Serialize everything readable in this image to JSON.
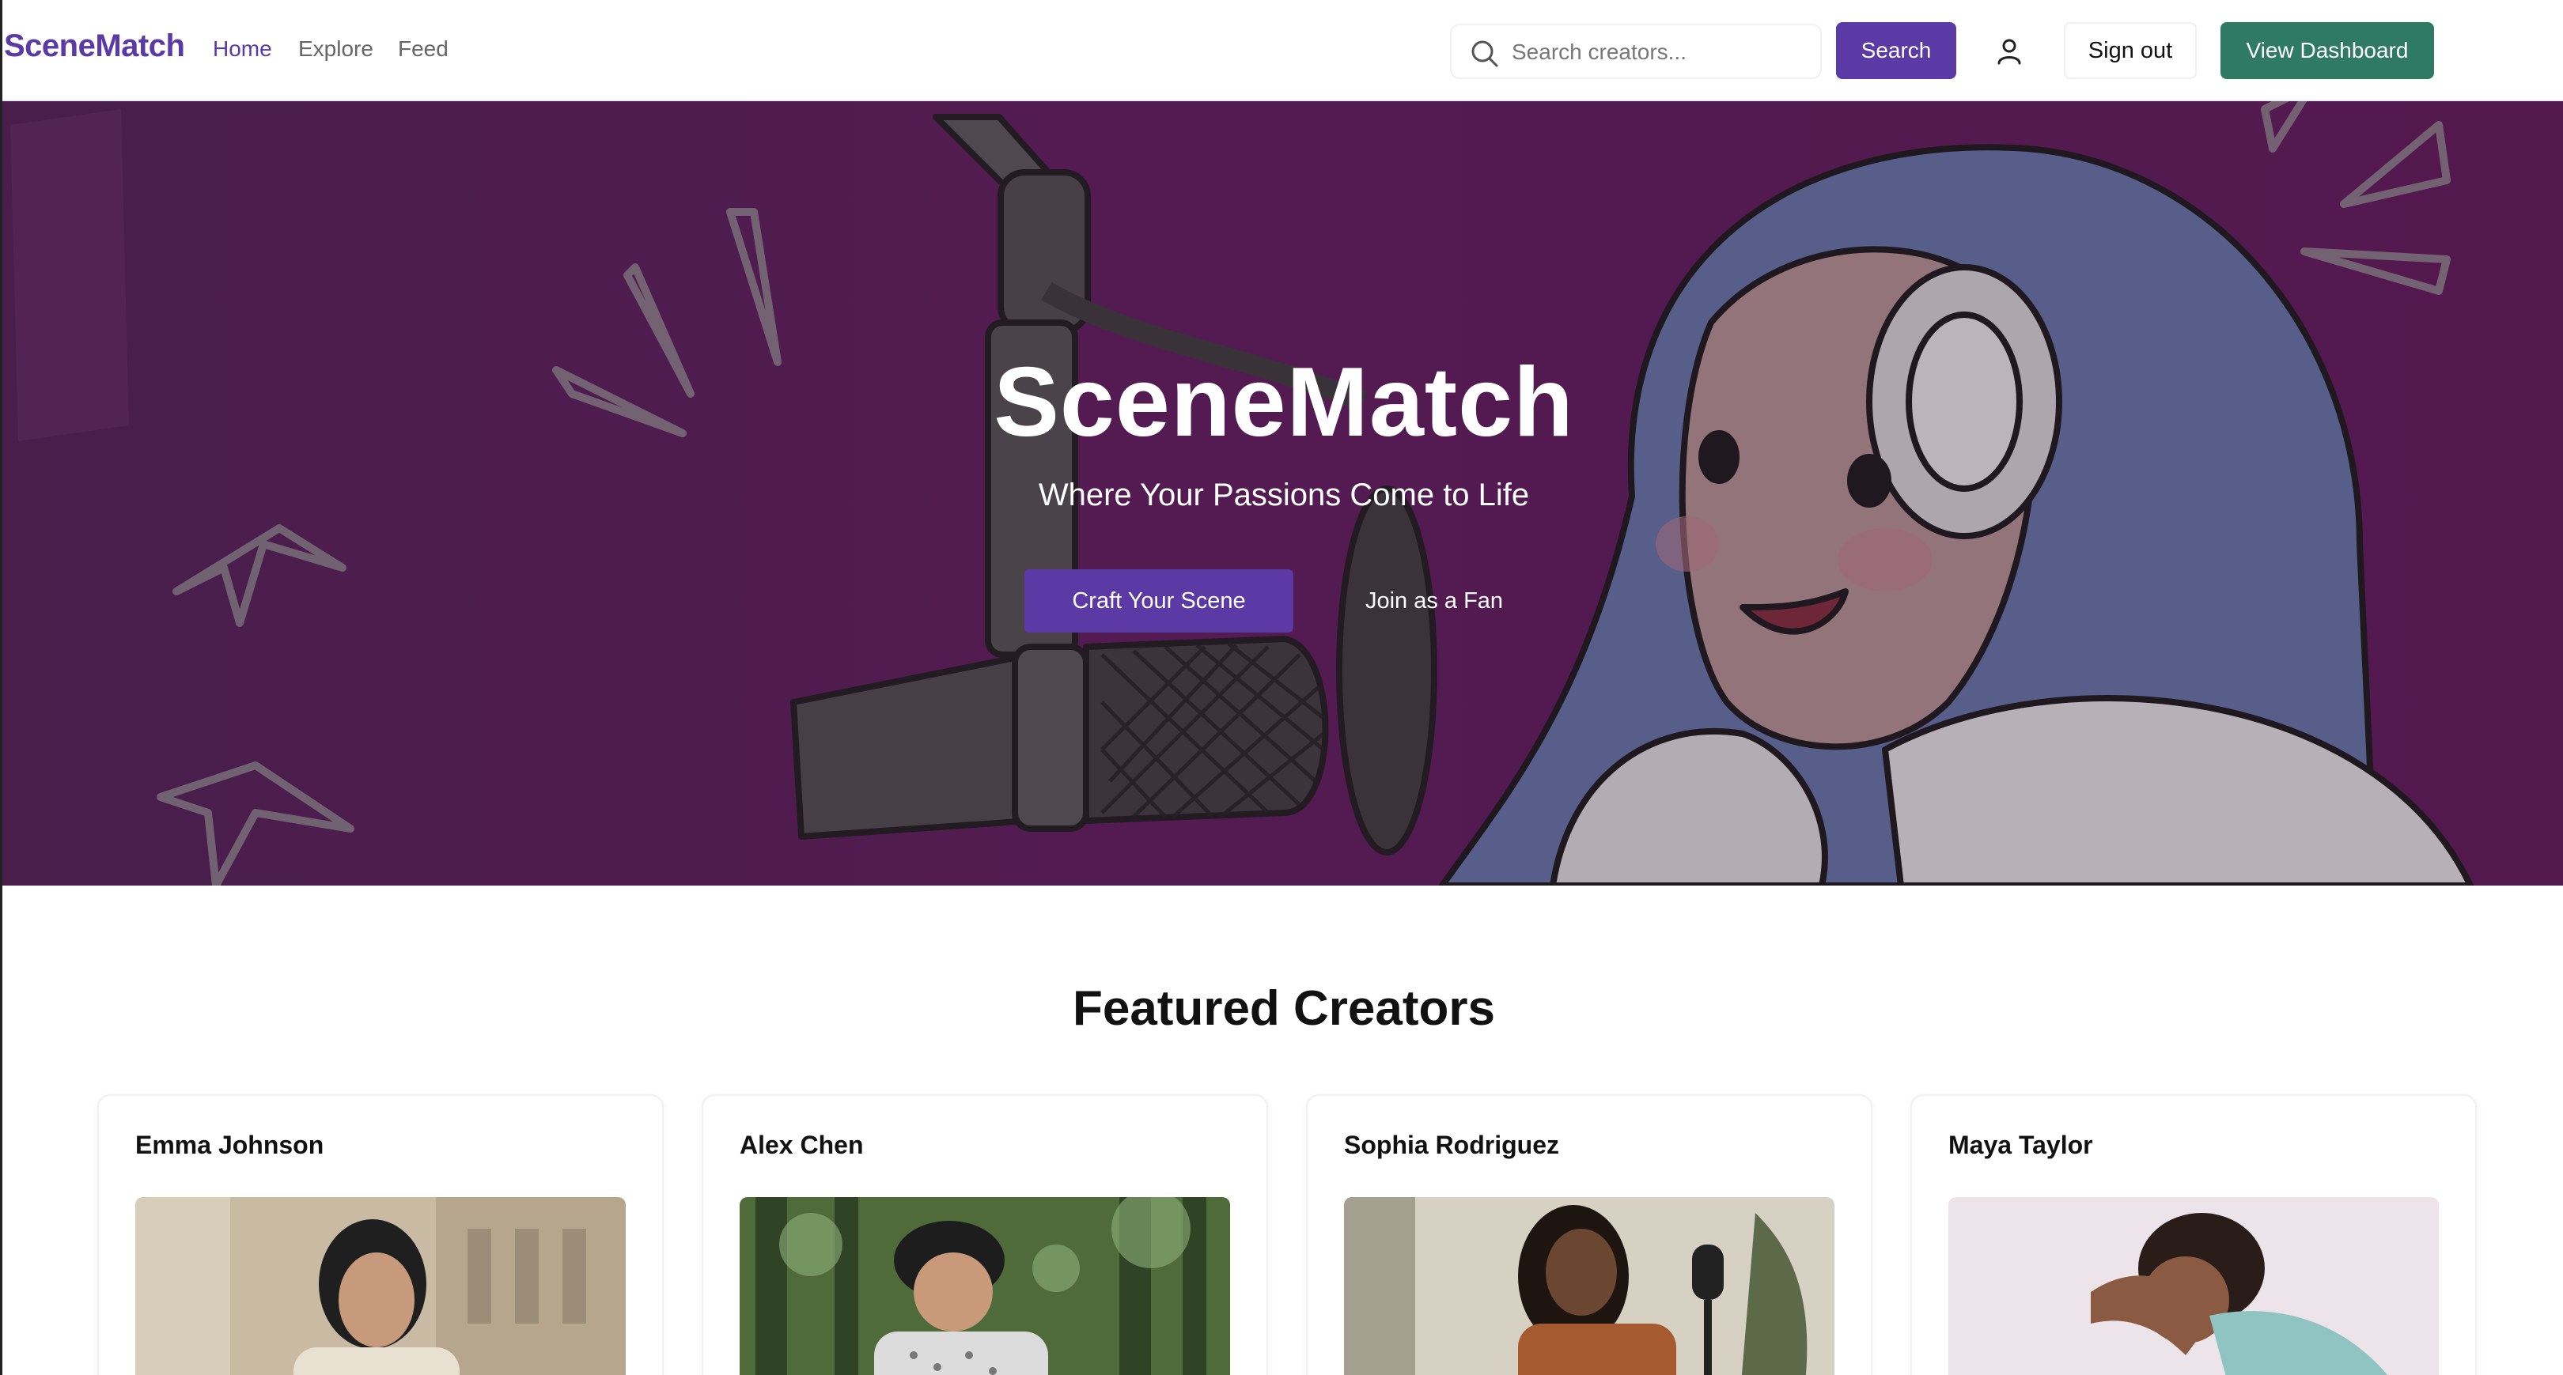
{
  "nav": {
    "brand": "SceneMatch",
    "links": [
      {
        "label": "Home",
        "active": true
      },
      {
        "label": "Explore",
        "active": false
      },
      {
        "label": "Feed",
        "active": false
      }
    ],
    "search_placeholder": "Search creators...",
    "search_button": "Search",
    "sign_out": "Sign out",
    "dashboard_button": "View Dashboard"
  },
  "hero": {
    "title": "SceneMatch",
    "subtitle": "Where Your Passions Come to Life",
    "primary_cta": "Craft Your Scene",
    "secondary_cta": "Join as a Fan"
  },
  "featured": {
    "title": "Featured Creators",
    "creators": [
      {
        "name": "Emma Johnson"
      },
      {
        "name": "Alex Chen"
      },
      {
        "name": "Sophia Rodriguez"
      },
      {
        "name": "Maya Taylor"
      }
    ]
  },
  "colors": {
    "brand_purple": "#5b3aa5",
    "dashboard_green": "#2e7a63",
    "hero_background": "#581e56"
  },
  "icons": [
    "search-icon",
    "user-icon"
  ]
}
